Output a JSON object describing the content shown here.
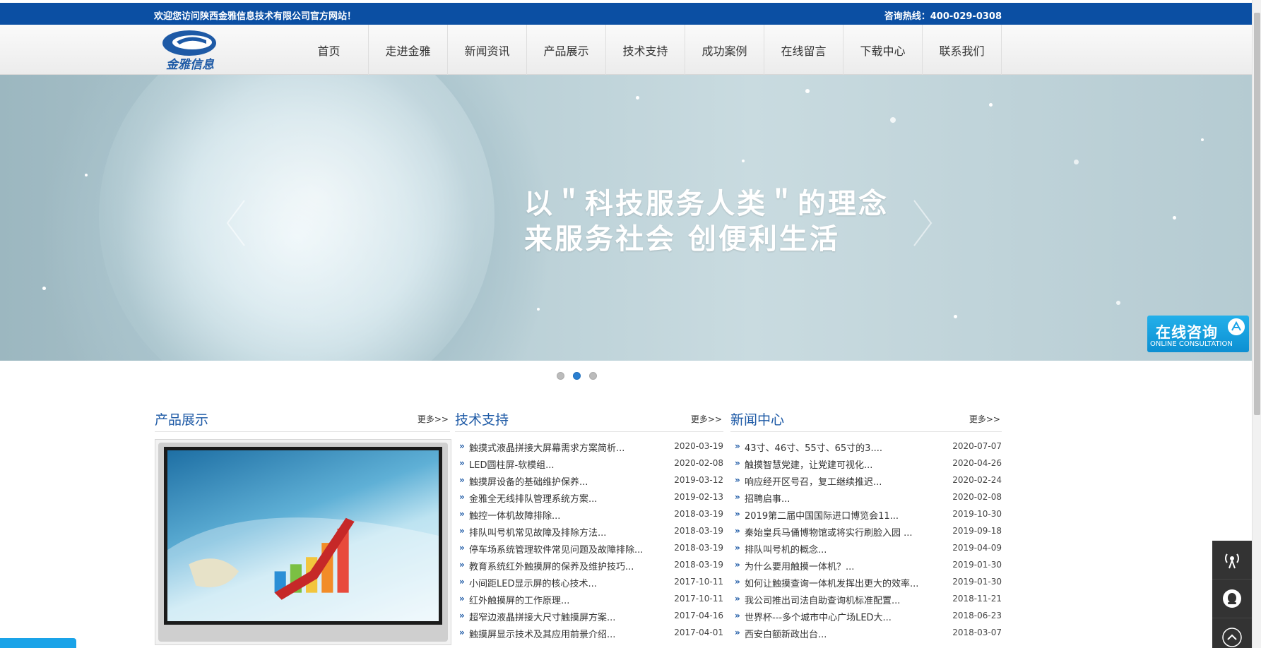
{
  "topbar": {
    "welcome": "欢迎您访问陕西金雅信息技术有限公司官方网站！",
    "hotline": "咨询热线：400-029-0308"
  },
  "logo": {
    "text": "金雅信息"
  },
  "nav": [
    {
      "label": "首页"
    },
    {
      "label": "走进金雅"
    },
    {
      "label": "新闻资讯"
    },
    {
      "label": "产品展示"
    },
    {
      "label": "技术支持"
    },
    {
      "label": "成功案例"
    },
    {
      "label": "在线留言"
    },
    {
      "label": "下载中心"
    },
    {
      "label": "联系我们"
    }
  ],
  "banner": {
    "line1": "以＂科技服务人类＂的理念",
    "line2": "来服务社会  创便利生活",
    "active_slide": 2,
    "slide_count": 3
  },
  "consult": {
    "title": "在线咨询",
    "subtitle": "ONLINE CONSULTATION"
  },
  "products": {
    "title": "产品展示",
    "more": "更多>>"
  },
  "tech": {
    "title": "技术支持",
    "more": "更多>>",
    "items": [
      {
        "text": "触摸式液晶拼接大屏幕需求方案简析...",
        "date": "2020-03-19"
      },
      {
        "text": "LED圆柱屏-软模组...",
        "date": "2020-02-08"
      },
      {
        "text": "触摸屏设备的基础维护保养...",
        "date": "2019-03-12"
      },
      {
        "text": "金雅全无线排队管理系统方案...",
        "date": "2019-02-13"
      },
      {
        "text": "触控一体机故障排除...",
        "date": "2018-03-19"
      },
      {
        "text": "排队叫号机常见故障及排除方法...",
        "date": "2018-03-19"
      },
      {
        "text": "停车场系统管理软件常见问题及故障排除...",
        "date": "2018-03-19"
      },
      {
        "text": "教育系统红外触摸屏的保养及维护技巧...",
        "date": "2018-03-19"
      },
      {
        "text": "小间距LED显示屏的核心技术...",
        "date": "2017-10-11"
      },
      {
        "text": "红外触摸屏的工作原理...",
        "date": "2017-10-11"
      },
      {
        "text": "超窄边液晶拼接大尺寸触摸屏方案...",
        "date": "2017-04-16"
      },
      {
        "text": "触摸屏显示技术及其应用前景介绍...",
        "date": "2017-04-01"
      }
    ]
  },
  "news": {
    "title": "新闻中心",
    "more": "更多>>",
    "items": [
      {
        "text": "43寸、46寸、55寸、65寸的3....",
        "date": "2020-07-07"
      },
      {
        "text": "触摸智慧党建，让党建可视化...",
        "date": "2020-04-26"
      },
      {
        "text": "响应经开区号召，复工继续推迟...",
        "date": "2020-02-24"
      },
      {
        "text": "招聘启事...",
        "date": "2020-02-08"
      },
      {
        "text": "2019第二届中国国际进口博览会11...",
        "date": "2019-10-30"
      },
      {
        "text": "秦始皇兵马俑博物馆或将实行刷脸入园 ...",
        "date": "2019-09-18"
      },
      {
        "text": "排队叫号机的概念...",
        "date": "2019-04-09"
      },
      {
        "text": "为什么要用触摸一体机？...",
        "date": "2019-01-30"
      },
      {
        "text": "如何让触摸查询一体机发挥出更大的效率...",
        "date": "2019-01-30"
      },
      {
        "text": "我公司推出司法自助查询机标准配置...",
        "date": "2018-11-21"
      },
      {
        "text": "世界杯---多个城市中心广场LED大...",
        "date": "2018-06-23"
      },
      {
        "text": "西安白额新政出台...",
        "date": "2018-03-07"
      }
    ]
  },
  "colors": {
    "topbar": "#0b4fa3",
    "accent": "#1e5aa6",
    "consult": "#1aa3e8"
  }
}
